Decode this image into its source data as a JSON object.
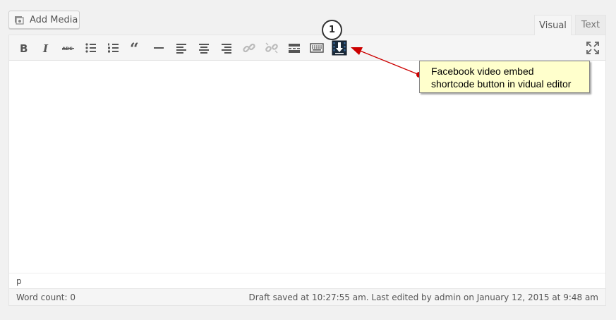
{
  "media": {
    "add_media_label": "Add Media"
  },
  "tabs": {
    "visual": "Visual",
    "text": "Text"
  },
  "toolbar": {
    "items": [
      "bold-icon",
      "italic-icon",
      "strikethrough-icon",
      "bulleted-list-icon",
      "numbered-list-icon",
      "blockquote-icon",
      "horizontal-line-icon",
      "align-left-icon",
      "align-center-icon",
      "align-right-icon",
      "insert-link-icon",
      "remove-link-icon",
      "read-more-icon",
      "toolbar-toggle-icon",
      "facebook-video-embed-icon"
    ],
    "fullscreen": "fullscreen-icon"
  },
  "editor": {
    "path": "p"
  },
  "status": {
    "word_count": "Word count: 0",
    "draft_saved": "Draft saved at 10:27:55 am. Last edited by admin on January 12, 2015 at 9:48 am"
  },
  "annotation": {
    "number": "1",
    "text": "Facebook video embed shortcode button in vidual editor",
    "arrow_color": "#cc0000"
  }
}
